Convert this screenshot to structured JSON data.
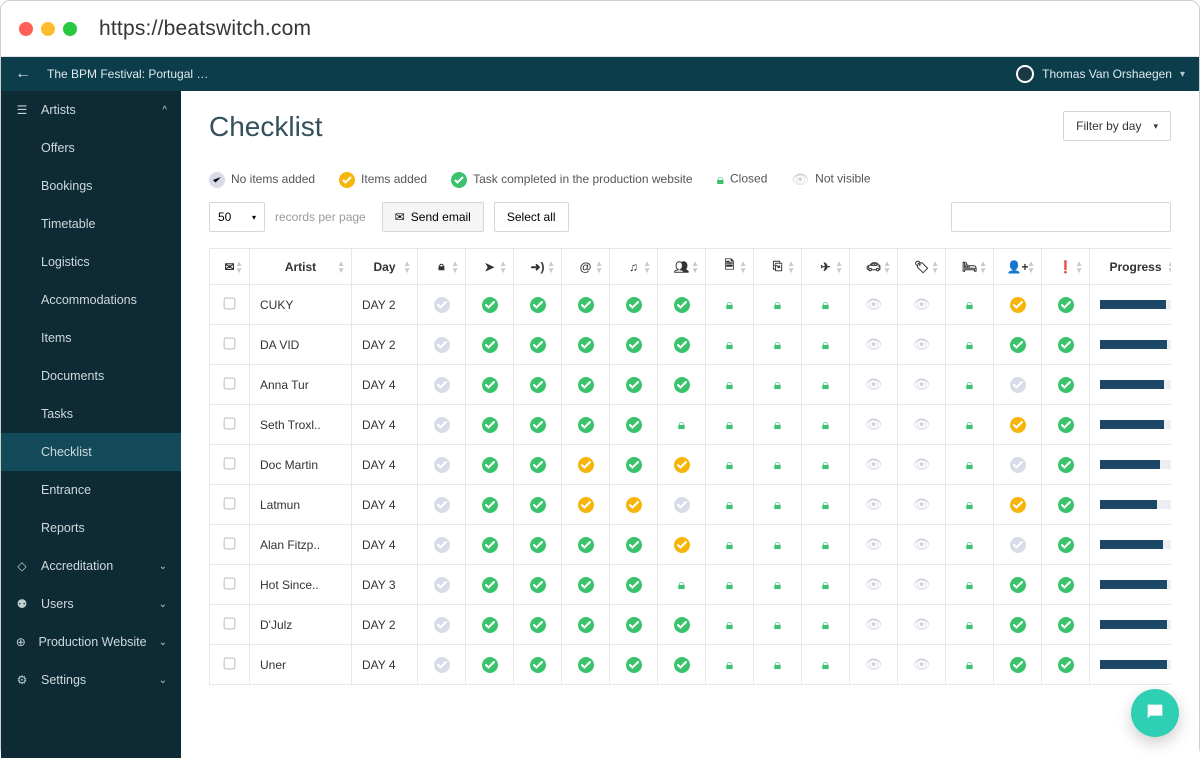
{
  "browser": {
    "url": "https://beatswitch.com"
  },
  "appbar": {
    "event_title": "The BPM Festival: Portugal …",
    "user_name": "Thomas Van Orshaegen"
  },
  "sidebar": {
    "parent": {
      "label": "Artists"
    },
    "items": [
      {
        "label": "Offers"
      },
      {
        "label": "Bookings"
      },
      {
        "label": "Timetable"
      },
      {
        "label": "Logistics"
      },
      {
        "label": "Accommodations"
      },
      {
        "label": "Items"
      },
      {
        "label": "Documents"
      },
      {
        "label": "Tasks"
      },
      {
        "label": "Checklist",
        "active": true
      },
      {
        "label": "Entrance"
      },
      {
        "label": "Reports"
      }
    ],
    "bottom": [
      {
        "label": "Accreditation",
        "icon": "tag-icon"
      },
      {
        "label": "Users",
        "icon": "users-icon"
      },
      {
        "label": "Production Website",
        "icon": "globe-icon"
      },
      {
        "label": "Settings",
        "icon": "gear-icon"
      }
    ]
  },
  "page": {
    "title": "Checklist",
    "filter_label": "Filter by day"
  },
  "legend": {
    "no_items": "No items added",
    "items_added": "Items added",
    "task_done": "Task completed in the production website",
    "closed": "Closed",
    "not_visible": "Not visible"
  },
  "toolbar": {
    "records_value": "50",
    "records_label": "records per page",
    "send_email": "Send email",
    "select_all": "Select all"
  },
  "columns": {
    "artist": "Artist",
    "day": "Day",
    "progress": "Progress",
    "icons": [
      "mail",
      "lock",
      "send",
      "login",
      "at",
      "music",
      "group",
      "doc",
      "copy",
      "plane",
      "car",
      "tag",
      "bed",
      "person-plus",
      "alert"
    ]
  },
  "rows": [
    {
      "artist": "CUKY",
      "day": "DAY 2",
      "cells": [
        "empty",
        "done",
        "done",
        "done",
        "done",
        "done",
        "lock",
        "lock",
        "lock",
        "hidden",
        "hidden",
        "lock",
        "added",
        "done"
      ],
      "progress": 92
    },
    {
      "artist": "DA VID",
      "day": "DAY 2",
      "cells": [
        "empty",
        "done",
        "done",
        "done",
        "done",
        "done",
        "lock",
        "lock",
        "lock",
        "hidden",
        "hidden",
        "lock",
        "done",
        "done"
      ],
      "progress": 94
    },
    {
      "artist": "Anna Tur",
      "day": "DAY 4",
      "cells": [
        "empty",
        "done",
        "done",
        "done",
        "done",
        "done",
        "lock",
        "lock",
        "lock",
        "hidden",
        "hidden",
        "lock",
        "empty",
        "done"
      ],
      "progress": 90
    },
    {
      "artist": "Seth Troxl..",
      "day": "DAY 4",
      "cells": [
        "empty",
        "done",
        "done",
        "done",
        "done",
        "lock",
        "lock",
        "lock",
        "lock",
        "hidden",
        "hidden",
        "lock",
        "added",
        "done"
      ],
      "progress": 90
    },
    {
      "artist": "Doc Martin",
      "day": "DAY 4",
      "cells": [
        "empty",
        "done",
        "done",
        "added",
        "done",
        "added",
        "lock",
        "lock",
        "lock",
        "hidden",
        "hidden",
        "lock",
        "empty",
        "done"
      ],
      "progress": 84
    },
    {
      "artist": "Latmun",
      "day": "DAY 4",
      "cells": [
        "empty",
        "done",
        "done",
        "added",
        "added",
        "empty",
        "lock",
        "lock",
        "lock",
        "hidden",
        "hidden",
        "lock",
        "added",
        "done"
      ],
      "progress": 80
    },
    {
      "artist": "Alan Fitzp..",
      "day": "DAY 4",
      "cells": [
        "empty",
        "done",
        "done",
        "done",
        "done",
        "added",
        "lock",
        "lock",
        "lock",
        "hidden",
        "hidden",
        "lock",
        "empty",
        "done"
      ],
      "progress": 88
    },
    {
      "artist": "Hot Since..",
      "day": "DAY 3",
      "cells": [
        "empty",
        "done",
        "done",
        "done",
        "done",
        "lock",
        "lock",
        "lock",
        "lock",
        "hidden",
        "hidden",
        "lock",
        "done",
        "done"
      ],
      "progress": 94
    },
    {
      "artist": "D'Julz",
      "day": "DAY 2",
      "cells": [
        "empty",
        "done",
        "done",
        "done",
        "done",
        "done",
        "lock",
        "lock",
        "lock",
        "hidden",
        "hidden",
        "lock",
        "done",
        "done"
      ],
      "progress": 94
    },
    {
      "artist": "Uner",
      "day": "DAY 4",
      "cells": [
        "empty",
        "done",
        "done",
        "done",
        "done",
        "done",
        "lock",
        "lock",
        "lock",
        "hidden",
        "hidden",
        "lock",
        "done",
        "done"
      ],
      "progress": 94
    }
  ]
}
